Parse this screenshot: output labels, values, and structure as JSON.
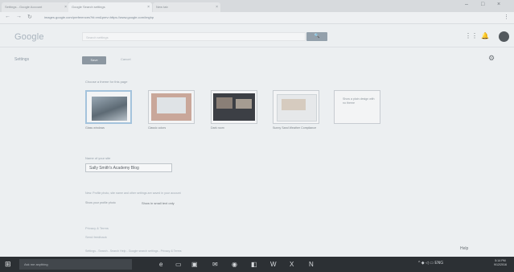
{
  "browser": {
    "tabs": [
      {
        "label": "Settings - Google Account"
      },
      {
        "label": "Google Search settings"
      },
      {
        "label": "New tab"
      }
    ],
    "address": "images.google.com/preferences?hl=en&prev=https://www.google.com/imghp",
    "back_icon": "back-arrow",
    "forward_icon": "forward-arrow",
    "reload_icon": "reload",
    "minimize": "–",
    "maximize": "□",
    "close": "×",
    "menu": "⋮"
  },
  "header": {
    "logo": "Google",
    "search_placeholder": "Search settings",
    "search_button": "🔍",
    "apps_icon": "⋮⋮",
    "notifications_icon": "🔔"
  },
  "toolbar": {
    "side_title": "Settings",
    "save_label": "Save",
    "cancel_label": "Cancel",
    "gear": "⚙"
  },
  "themes": {
    "label": "Choose a theme for this page",
    "items": [
      {
        "caption": "Glass windows"
      },
      {
        "caption": "Classic colors"
      },
      {
        "caption": "Dark room"
      },
      {
        "caption": "Sunny Sand Weather Compliance"
      },
      {
        "caption": "Show a plain design with no theme"
      }
    ]
  },
  "name_field": {
    "label": "Name of your site",
    "value": "Sally Smith's Academy Blog"
  },
  "info_line": "New: Profile photo, site name and other settings are saved in your account",
  "option": {
    "label": "Show your profile photo",
    "value": "Show in small text only"
  },
  "footer": {
    "links": [
      "Privacy & Terms",
      "Send feedback"
    ],
    "line": "Settings - Search - Search Help - Google search settings - Privacy & Terms",
    "feedback": "Help"
  },
  "taskbar": {
    "search_placeholder": "Ask me anything",
    "clock_time": "5:14 PM",
    "clock_date": "9/12/2016",
    "tray": "^ ◆ ◁ ▭ ENG"
  }
}
